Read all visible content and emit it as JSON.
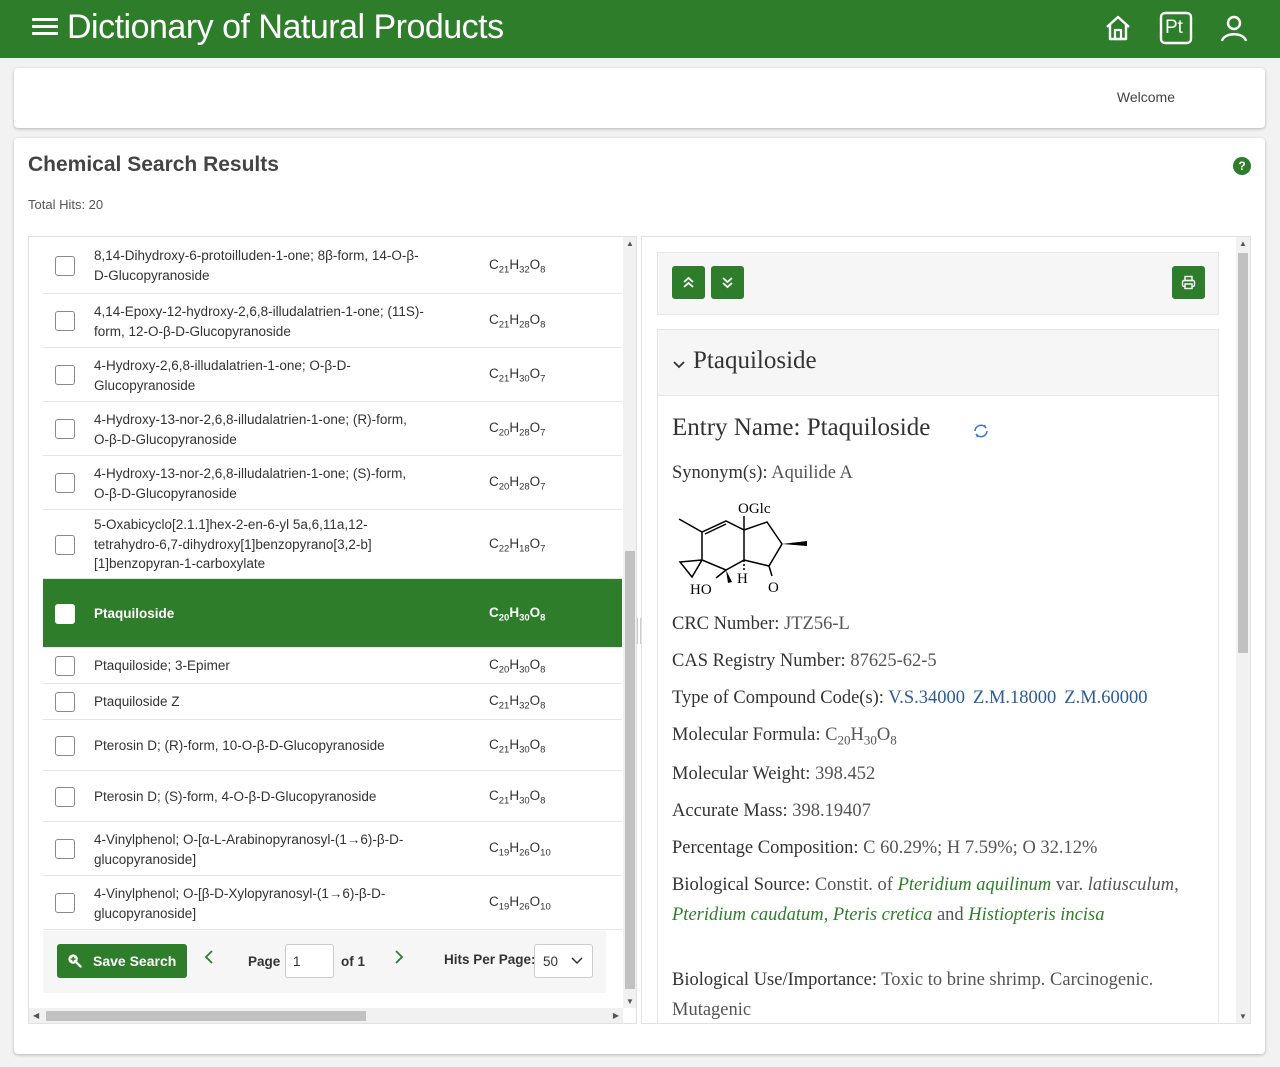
{
  "app": {
    "title": "Dictionary of Natural Products",
    "welcome": "Welcome",
    "icons": [
      "menu-icon",
      "home-icon",
      "pt-icon",
      "user-icon"
    ],
    "pt_label": "Pt",
    "brand_color": "#2e7d2a"
  },
  "results": {
    "title": "Chemical Search Results",
    "help_label": "?",
    "total_hits": "Total Hits: 20",
    "rows": [
      {
        "name": "8,14-Dihydroxy-6-protoilluden-1-one; 8β-form, 14-O-β-D-Glucopyranoside",
        "formula": {
          "c": "21",
          "h": "32",
          "o": "8"
        },
        "selected": false
      },
      {
        "name": "4,14-Epoxy-12-hydroxy-2,6,8-illudalatrien-1-one; (11S)-form, 12-O-β-D-Glucopyranoside",
        "formula": {
          "c": "21",
          "h": "28",
          "o": "8"
        },
        "selected": false
      },
      {
        "name": "4-Hydroxy-2,6,8-illudalatrien-1-one; O-β-D-Glucopyranoside",
        "formula": {
          "c": "21",
          "h": "30",
          "o": "7"
        },
        "selected": false
      },
      {
        "name": "4-Hydroxy-13-nor-2,6,8-illudalatrien-1-one; (R)-form, O-β-D-Glucopyranoside",
        "formula": {
          "c": "20",
          "h": "28",
          "o": "7"
        },
        "selected": false
      },
      {
        "name": "4-Hydroxy-13-nor-2,6,8-illudalatrien-1-one; (S)-form, O-β-D-Glucopyranoside",
        "formula": {
          "c": "20",
          "h": "28",
          "o": "7"
        },
        "selected": false
      },
      {
        "name": "5-Oxabicyclo[2.1.1]hex-2-en-6-yl 5a,6,11a,12-tetrahydro-6,7-dihydroxy[1]benzopyrano[3,2-b][1]benzopyran-1-carboxylate",
        "formula": {
          "c": "22",
          "h": "18",
          "o": "7"
        },
        "selected": false
      },
      {
        "name": "Ptaquiloside",
        "formula": {
          "c": "20",
          "h": "30",
          "o": "8"
        },
        "selected": true
      },
      {
        "name": "Ptaquiloside; 3-Epimer",
        "formula": {
          "c": "20",
          "h": "30",
          "o": "8"
        },
        "selected": false
      },
      {
        "name": "Ptaquiloside Z",
        "formula": {
          "c": "21",
          "h": "32",
          "o": "8"
        },
        "selected": false
      },
      {
        "name": "Pterosin D; (R)-form, 10-O-β-D-Glucopyranoside",
        "formula": {
          "c": "21",
          "h": "30",
          "o": "8"
        },
        "selected": false
      },
      {
        "name": "Pterosin D; (S)-form, 4-O-β-D-Glucopyranoside",
        "formula": {
          "c": "21",
          "h": "30",
          "o": "8"
        },
        "selected": false
      },
      {
        "name": "4-Vinylphenol; O-[α-L-Arabinopyranosyl-(1→6)-β-D-glucopyranoside]",
        "formula": {
          "c": "19",
          "h": "26",
          "o": "10"
        },
        "selected": false
      },
      {
        "name": "4-Vinylphenol; O-[β-D-Xylopyranosyl-(1→6)-β-D-glucopyranoside]",
        "formula": {
          "c": "19",
          "h": "26",
          "o": "10"
        },
        "selected": false
      }
    ]
  },
  "pager": {
    "save_label": "Save Search",
    "page_label": "Page",
    "page_value": "1",
    "of_label": "of 1",
    "hits_label": "Hits Per Page:",
    "hits_value": "50"
  },
  "entry": {
    "header_title": "Ptaquiloside",
    "entry_name_label": "Entry Name:",
    "entry_name": "Ptaquiloside",
    "synonyms_label": "Synonym(s):",
    "synonyms": "Aquilide A",
    "structure_labels": {
      "oglc": "OGlc",
      "ho": "HO",
      "h": "H",
      "o": "O"
    },
    "crc_label": "CRC Number:",
    "crc": "JTZ56-L",
    "cas_label": "CAS Registry Number:",
    "cas": "87625-62-5",
    "type_label": "Type of Compound Code(s):",
    "type_codes": [
      "V.S.34000",
      "Z.M.18000",
      "Z.M.60000"
    ],
    "formula_label": "Molecular Formula:",
    "formula": {
      "c": "20",
      "h": "30",
      "o": "8"
    },
    "mw_label": "Molecular Weight:",
    "mw": "398.452",
    "mass_label": "Accurate Mass:",
    "mass": "398.19407",
    "pc_label": "Percentage Composition:",
    "pc": "C 60.29%; H 7.59%; O 32.12%",
    "bio_source_label": "Biological Source:",
    "bio_source_prefix": "Constit. of",
    "bio_species_1": "Pteridium aquilinum",
    "bio_var": "var.",
    "bio_variety": "latiusculum,",
    "bio_species_2": "Pteridium caudatum,",
    "bio_species_3": "Pteris cretica",
    "bio_and": "and",
    "bio_species_4": "Histiopteris incisa",
    "bio_use_label": "Biological Use/Importance:",
    "bio_use": "Toxic to brine shrimp. Carcinogenic. Mutagenic"
  }
}
